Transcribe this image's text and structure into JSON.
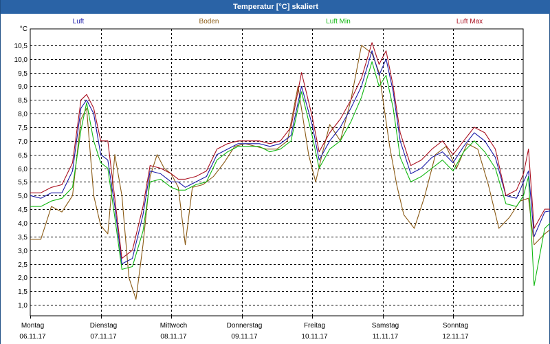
{
  "window": {
    "title": "Temperatur [°C] skaliert"
  },
  "chart_data": {
    "type": "line",
    "title": "Temperatur [°C] skaliert",
    "ylabel": "°C",
    "ylim": [
      0.6,
      11.1
    ],
    "yticks": [
      "1,0",
      "1,5",
      "2,0",
      "2,5",
      "3,0",
      "3,5",
      "4,0",
      "4,5",
      "5,0",
      "5,5",
      "6,0",
      "6,5",
      "7,0",
      "7,5",
      "8,0",
      "8,5",
      "9,0",
      "9,5",
      "10,0",
      "10,5"
    ],
    "ytick_values": [
      1.0,
      1.5,
      2.0,
      2.5,
      3.0,
      3.5,
      4.0,
      4.5,
      5.0,
      5.5,
      6.0,
      6.5,
      7.0,
      7.5,
      8.0,
      8.5,
      9.0,
      9.5,
      10.0,
      10.5
    ],
    "xlim": [
      0,
      7.07
    ],
    "x_day_labels": [
      {
        "day": "Montag",
        "date": "06.11.17"
      },
      {
        "day": "Dienstag",
        "date": "07.11.17"
      },
      {
        "day": "Mittwoch",
        "date": "08.11.17"
      },
      {
        "day": "Donnerstag",
        "date": "09.11.17"
      },
      {
        "day": "Freitag",
        "date": "10.11.17"
      },
      {
        "day": "Samstag",
        "date": "11.11.17"
      },
      {
        "day": "Sonntag",
        "date": "12.11.17"
      }
    ],
    "grid": true,
    "legend_position": "top",
    "series": [
      {
        "name": "Luft",
        "color": "#1a1aa8",
        "points": [
          [
            0,
            5.0
          ],
          [
            0.15,
            4.9
          ],
          [
            0.3,
            5.1
          ],
          [
            0.45,
            5.1
          ],
          [
            0.6,
            5.9
          ],
          [
            0.72,
            8.2
          ],
          [
            0.8,
            8.5
          ],
          [
            0.9,
            8.0
          ],
          [
            1.0,
            6.5
          ],
          [
            1.1,
            6.3
          ],
          [
            1.2,
            4.6
          ],
          [
            1.3,
            2.5
          ],
          [
            1.45,
            2.7
          ],
          [
            1.6,
            4.3
          ],
          [
            1.7,
            5.9
          ],
          [
            1.85,
            5.8
          ],
          [
            2.0,
            5.5
          ],
          [
            2.1,
            5.5
          ],
          [
            2.2,
            5.3
          ],
          [
            2.35,
            5.5
          ],
          [
            2.5,
            5.7
          ],
          [
            2.65,
            6.5
          ],
          [
            2.8,
            6.7
          ],
          [
            2.95,
            6.9
          ],
          [
            3.1,
            6.9
          ],
          [
            3.25,
            6.9
          ],
          [
            3.4,
            6.8
          ],
          [
            3.55,
            6.9
          ],
          [
            3.7,
            7.2
          ],
          [
            3.85,
            9.0
          ],
          [
            4.0,
            7.6
          ],
          [
            4.1,
            6.3
          ],
          [
            4.25,
            7.0
          ],
          [
            4.4,
            7.5
          ],
          [
            4.55,
            8.2
          ],
          [
            4.7,
            9.0
          ],
          [
            4.85,
            10.3
          ],
          [
            4.95,
            9.4
          ],
          [
            5.05,
            10.0
          ],
          [
            5.15,
            8.8
          ],
          [
            5.25,
            7.0
          ],
          [
            5.4,
            5.8
          ],
          [
            5.55,
            6.0
          ],
          [
            5.7,
            6.4
          ],
          [
            5.85,
            6.6
          ],
          [
            6.0,
            6.2
          ],
          [
            6.15,
            6.8
          ],
          [
            6.3,
            7.3
          ],
          [
            6.45,
            7.0
          ],
          [
            6.6,
            6.4
          ],
          [
            6.75,
            5.0
          ],
          [
            6.9,
            4.9
          ],
          [
            7.0,
            5.5
          ],
          [
            7.07,
            5.9
          ],
          [
            7.15,
            3.5
          ],
          [
            7.3,
            4.4
          ],
          [
            7.5,
            4.5
          ],
          [
            7.6,
            4.55
          ]
        ]
      },
      {
        "name": "Boden",
        "color": "#8a5a14",
        "points": [
          [
            0,
            3.4
          ],
          [
            0.15,
            3.4
          ],
          [
            0.3,
            4.6
          ],
          [
            0.45,
            4.4
          ],
          [
            0.6,
            5.0
          ],
          [
            0.72,
            7.8
          ],
          [
            0.8,
            8.2
          ],
          [
            0.9,
            5.0
          ],
          [
            1.0,
            3.9
          ],
          [
            1.1,
            3.6
          ],
          [
            1.2,
            6.5
          ],
          [
            1.3,
            5.0
          ],
          [
            1.4,
            2.0
          ],
          [
            1.5,
            1.2
          ],
          [
            1.6,
            3.2
          ],
          [
            1.7,
            5.7
          ],
          [
            1.8,
            6.5
          ],
          [
            1.9,
            6.0
          ],
          [
            2.0,
            5.8
          ],
          [
            2.1,
            5.3
          ],
          [
            2.2,
            3.2
          ],
          [
            2.3,
            5.3
          ],
          [
            2.45,
            5.4
          ],
          [
            2.6,
            5.7
          ],
          [
            2.75,
            6.2
          ],
          [
            2.9,
            6.8
          ],
          [
            3.05,
            6.9
          ],
          [
            3.2,
            6.8
          ],
          [
            3.35,
            6.7
          ],
          [
            3.5,
            6.7
          ],
          [
            3.65,
            7.0
          ],
          [
            3.8,
            9.0
          ],
          [
            3.95,
            6.5
          ],
          [
            4.05,
            5.5
          ],
          [
            4.15,
            6.6
          ],
          [
            4.25,
            7.6
          ],
          [
            4.4,
            7.0
          ],
          [
            4.55,
            8.5
          ],
          [
            4.7,
            10.5
          ],
          [
            4.85,
            10.2
          ],
          [
            4.95,
            9.5
          ],
          [
            5.1,
            6.8
          ],
          [
            5.2,
            5.4
          ],
          [
            5.3,
            4.3
          ],
          [
            5.45,
            3.8
          ],
          [
            5.6,
            5.0
          ],
          [
            5.75,
            6.5
          ],
          [
            5.9,
            6.8
          ],
          [
            6.05,
            6.0
          ],
          [
            6.2,
            6.9
          ],
          [
            6.35,
            6.7
          ],
          [
            6.5,
            5.4
          ],
          [
            6.65,
            3.8
          ],
          [
            6.8,
            4.2
          ],
          [
            6.95,
            4.8
          ],
          [
            7.07,
            4.9
          ],
          [
            7.15,
            3.2
          ],
          [
            7.3,
            3.6
          ],
          [
            7.5,
            4.0
          ],
          [
            7.6,
            4.2
          ]
        ]
      },
      {
        "name": "Luft Min",
        "color": "#11b811",
        "points": [
          [
            0,
            4.6
          ],
          [
            0.15,
            4.6
          ],
          [
            0.3,
            4.8
          ],
          [
            0.45,
            4.9
          ],
          [
            0.6,
            5.3
          ],
          [
            0.72,
            7.4
          ],
          [
            0.8,
            8.4
          ],
          [
            0.9,
            7.0
          ],
          [
            1.0,
            6.2
          ],
          [
            1.1,
            6.0
          ],
          [
            1.2,
            4.2
          ],
          [
            1.3,
            2.3
          ],
          [
            1.45,
            2.4
          ],
          [
            1.6,
            3.7
          ],
          [
            1.7,
            5.5
          ],
          [
            1.85,
            5.6
          ],
          [
            2.0,
            5.3
          ],
          [
            2.1,
            5.2
          ],
          [
            2.2,
            5.2
          ],
          [
            2.35,
            5.4
          ],
          [
            2.5,
            5.5
          ],
          [
            2.65,
            6.3
          ],
          [
            2.8,
            6.6
          ],
          [
            2.95,
            6.8
          ],
          [
            3.1,
            6.8
          ],
          [
            3.25,
            6.8
          ],
          [
            3.4,
            6.6
          ],
          [
            3.55,
            6.7
          ],
          [
            3.7,
            7.0
          ],
          [
            3.85,
            8.8
          ],
          [
            4.0,
            7.2
          ],
          [
            4.1,
            6.0
          ],
          [
            4.25,
            6.7
          ],
          [
            4.4,
            7.0
          ],
          [
            4.55,
            7.7
          ],
          [
            4.7,
            8.6
          ],
          [
            4.85,
            9.9
          ],
          [
            4.95,
            9.0
          ],
          [
            5.05,
            9.4
          ],
          [
            5.15,
            8.2
          ],
          [
            5.25,
            6.4
          ],
          [
            5.4,
            5.5
          ],
          [
            5.55,
            5.7
          ],
          [
            5.7,
            6.0
          ],
          [
            5.85,
            6.3
          ],
          [
            6.0,
            5.9
          ],
          [
            6.15,
            6.6
          ],
          [
            6.3,
            7.0
          ],
          [
            6.45,
            6.6
          ],
          [
            6.6,
            6.0
          ],
          [
            6.75,
            4.7
          ],
          [
            6.9,
            4.6
          ],
          [
            7.0,
            5.0
          ],
          [
            7.07,
            5.7
          ],
          [
            7.15,
            1.7
          ],
          [
            7.3,
            3.8
          ],
          [
            7.5,
            4.3
          ],
          [
            7.6,
            4.5
          ]
        ]
      },
      {
        "name": "Luft Max",
        "color": "#aa1020",
        "points": [
          [
            0,
            5.1
          ],
          [
            0.15,
            5.1
          ],
          [
            0.3,
            5.3
          ],
          [
            0.45,
            5.4
          ],
          [
            0.6,
            6.2
          ],
          [
            0.72,
            8.5
          ],
          [
            0.8,
            8.7
          ],
          [
            0.9,
            8.2
          ],
          [
            1.0,
            7.0
          ],
          [
            1.1,
            7.0
          ],
          [
            1.2,
            4.9
          ],
          [
            1.3,
            2.7
          ],
          [
            1.45,
            3.0
          ],
          [
            1.6,
            4.6
          ],
          [
            1.7,
            6.1
          ],
          [
            1.85,
            6.0
          ],
          [
            2.0,
            5.8
          ],
          [
            2.1,
            5.6
          ],
          [
            2.2,
            5.6
          ],
          [
            2.35,
            5.7
          ],
          [
            2.5,
            5.9
          ],
          [
            2.65,
            6.7
          ],
          [
            2.8,
            6.9
          ],
          [
            2.95,
            7.0
          ],
          [
            3.1,
            7.0
          ],
          [
            3.25,
            7.0
          ],
          [
            3.4,
            6.9
          ],
          [
            3.55,
            7.0
          ],
          [
            3.7,
            7.5
          ],
          [
            3.85,
            9.5
          ],
          [
            4.0,
            7.9
          ],
          [
            4.1,
            6.6
          ],
          [
            4.25,
            7.3
          ],
          [
            4.4,
            7.8
          ],
          [
            4.55,
            8.5
          ],
          [
            4.7,
            9.3
          ],
          [
            4.85,
            10.6
          ],
          [
            4.95,
            9.8
          ],
          [
            5.05,
            10.3
          ],
          [
            5.15,
            9.0
          ],
          [
            5.25,
            7.3
          ],
          [
            5.4,
            6.1
          ],
          [
            5.55,
            6.3
          ],
          [
            5.7,
            6.7
          ],
          [
            5.85,
            7.0
          ],
          [
            6.0,
            6.5
          ],
          [
            6.15,
            7.0
          ],
          [
            6.3,
            7.5
          ],
          [
            6.45,
            7.3
          ],
          [
            6.6,
            6.7
          ],
          [
            6.75,
            5.0
          ],
          [
            6.9,
            5.2
          ],
          [
            7.0,
            5.8
          ],
          [
            7.07,
            6.7
          ],
          [
            7.15,
            3.8
          ],
          [
            7.3,
            4.5
          ],
          [
            7.5,
            4.5
          ],
          [
            7.6,
            4.6
          ]
        ]
      }
    ]
  }
}
